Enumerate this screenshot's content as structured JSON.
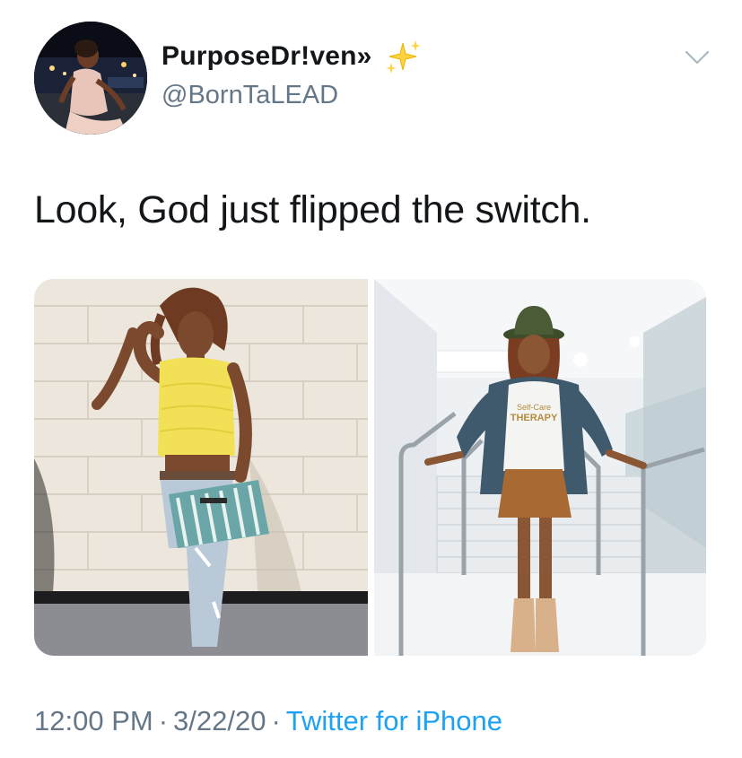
{
  "user": {
    "display_name": "PurposeDr!ven»",
    "handle": "@BornTaLEAD",
    "avatar_icon": "avatar",
    "badge_icon": "sparkles-icon"
  },
  "menu": {
    "icon": "chevron-down-icon"
  },
  "tweet": {
    "text": "Look, God just flipped the switch."
  },
  "media": {
    "left_photo": {
      "shirt_text": "",
      "icon": "photo"
    },
    "right_photo": {
      "hoodie_text_line1": "Self-Care",
      "hoodie_text_line2": "THERAPY",
      "icon": "photo"
    }
  },
  "meta": {
    "time": "12:00 PM",
    "separator": "·",
    "date": "3/22/20",
    "source": "Twitter for iPhone"
  },
  "colors": {
    "link": "#1da1f2",
    "secondary_text": "#657786",
    "primary_text": "#14171a"
  }
}
